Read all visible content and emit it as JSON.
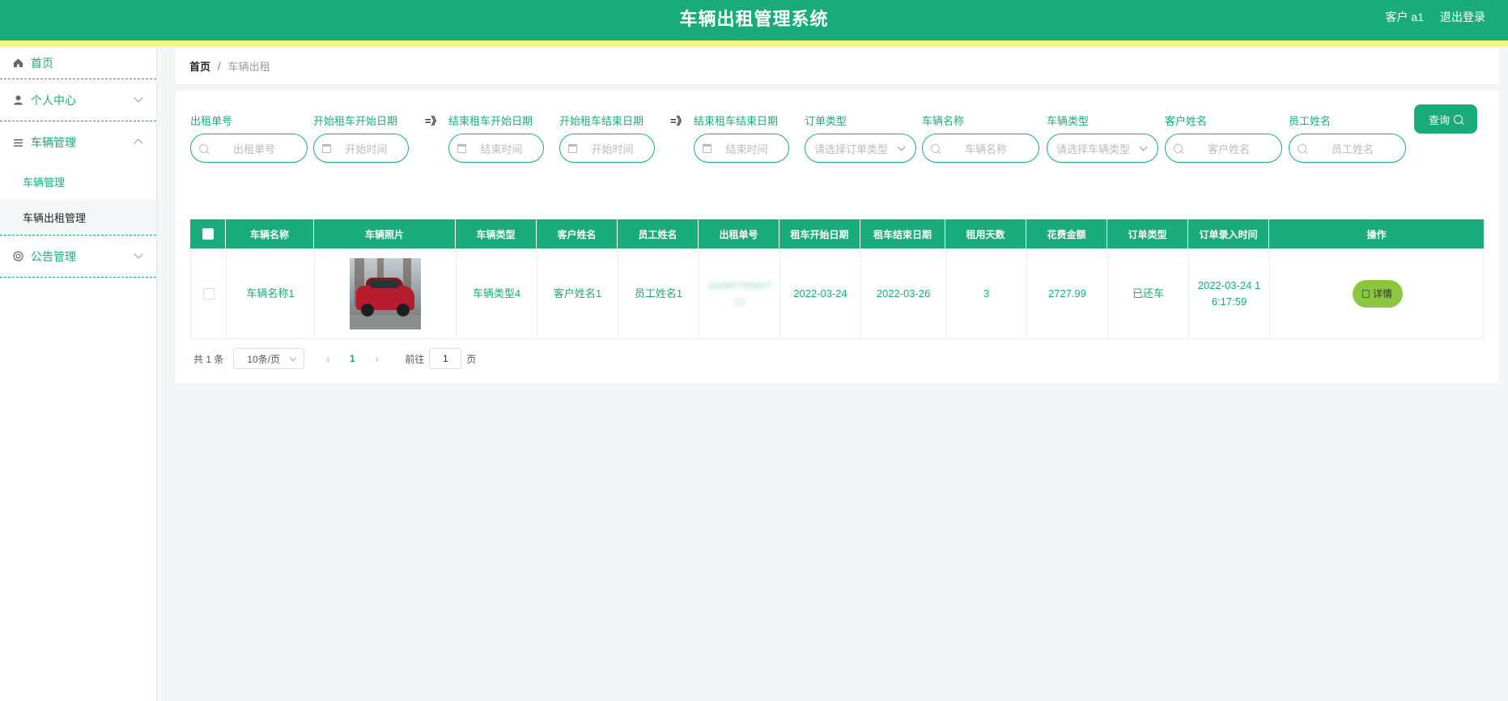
{
  "header": {
    "title": "车辆出租管理系统",
    "user": "客户 a1",
    "logout": "退出登录"
  },
  "sidebar": {
    "items": [
      {
        "label": "首页",
        "icon": "home-icon"
      },
      {
        "label": "个人中心",
        "icon": "user-icon"
      },
      {
        "label": "车辆管理",
        "icon": "list-icon",
        "children": [
          "车辆管理",
          "车辆出租管理"
        ]
      },
      {
        "label": "公告管理",
        "icon": "announcement-icon"
      }
    ]
  },
  "breadcrumb": {
    "home": "首页",
    "separator": "/",
    "current": "车辆出租"
  },
  "filters": {
    "order_no": {
      "label": "出租单号",
      "placeholder": "出租单号"
    },
    "rent_start_from": {
      "label": "开始租车开始日期",
      "placeholder": "开始时间"
    },
    "rent_start_to": {
      "label": "结束租车开始日期",
      "placeholder": "结束时间"
    },
    "rent_end_from": {
      "label": "开始租车结束日期",
      "placeholder": "开始时间"
    },
    "rent_end_to": {
      "label": "结束租车结束日期",
      "placeholder": "结束时间"
    },
    "order_type": {
      "label": "订单类型",
      "placeholder": "请选择订单类型"
    },
    "vehicle_name": {
      "label": "车辆名称",
      "placeholder": "车辆名称"
    },
    "vehicle_type": {
      "label": "车辆类型",
      "placeholder": "请选择车辆类型"
    },
    "customer_name": {
      "label": "客户姓名",
      "placeholder": "客户姓名"
    },
    "staff_name": {
      "label": "员工姓名",
      "placeholder": "员工姓名"
    },
    "range_arrow": "=》",
    "query_button": "查询"
  },
  "table": {
    "columns": [
      "车辆名称",
      "车辆照片",
      "车辆类型",
      "客户姓名",
      "员工姓名",
      "出租单号",
      "租车开始日期",
      "租车结束日期",
      "租用天数",
      "花费金额",
      "订单类型",
      "订单录入时间",
      "操作"
    ],
    "rows": [
      {
        "vehicle_name": "车辆名称1",
        "vehicle_type": "车辆类型4",
        "customer_name": "客户姓名1",
        "staff_name": "员工姓名1",
        "order_no": "1648078860713",
        "rent_start": "2022-03-24",
        "rent_end": "2022-03-26",
        "days": "3",
        "amount": "2727.99",
        "order_type": "已还车",
        "created_at": "2022-03-24 16:17:59",
        "action": "详情"
      }
    ]
  },
  "pagination": {
    "total": "共 1 条",
    "page_size": "10条/页",
    "current_page": "1",
    "goto_label": "前往",
    "goto_value": "1",
    "page_unit": "页"
  },
  "colors": {
    "primary": "#1aab7a",
    "stripe": "#f4f77a",
    "detail_button": "#8cc63f"
  }
}
